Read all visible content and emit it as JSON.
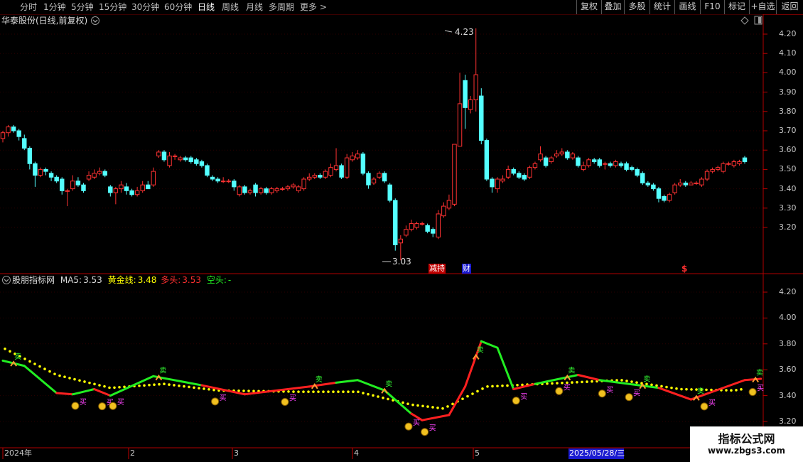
{
  "toolbar": {
    "periods": [
      "分时",
      "1分钟",
      "5分钟",
      "15分钟",
      "30分钟",
      "60分钟",
      "日线",
      "周线",
      "月线",
      "多周期",
      "更多 >"
    ],
    "active_period": "日线",
    "right_buttons": [
      "复权",
      "叠加",
      "多股",
      "统计",
      "画线",
      "F10",
      "标记",
      "+自选",
      "返回"
    ]
  },
  "main_panel": {
    "title": "华泰股份(日线,前复权)",
    "high_label": "4.23",
    "low_label": "3.03",
    "event_markers": [
      "减持",
      "财"
    ],
    "s_marker": "$",
    "y_ticks": [
      "4.20",
      "4.10",
      "4.00",
      "3.90",
      "3.80",
      "3.70",
      "3.60",
      "3.50",
      "3.40",
      "3.30",
      "3.20"
    ]
  },
  "indicator_panel": {
    "name": "股朋指标网",
    "ma5_label": "MA5:",
    "ma5_value": "3.53",
    "gold_label": "黄金线:",
    "gold_value": "3.48",
    "long_label": "多头:",
    "long_value": "3.53",
    "short_label": "空头:",
    "short_value": "-",
    "buy_text": "买",
    "sell_text": "卖",
    "y_ticks": [
      "4.20",
      "4.00",
      "3.80",
      "3.60",
      "3.40",
      "3.20"
    ]
  },
  "date_axis": {
    "labels": [
      "2024年",
      "2",
      "3",
      "4",
      "5"
    ],
    "cursor_date": "2025/05/28/三"
  },
  "watermark": {
    "line1": "指标公式网",
    "line2": "www.zbgs3.com"
  },
  "colors": {
    "up": "#ff3232",
    "down": "#54ffff",
    "gold_line": "#ffff00",
    "long_line": "#ff2020",
    "short_line": "#22ee22",
    "axis": "#c00000"
  },
  "chart_data": {
    "type": "candlestick",
    "ylim": [
      3.03,
      4.23
    ],
    "candles": [
      {
        "o": 3.66,
        "c": 3.69,
        "h": 3.7,
        "l": 3.64
      },
      {
        "o": 3.69,
        "c": 3.72,
        "h": 3.73,
        "l": 3.67
      },
      {
        "o": 3.72,
        "c": 3.7,
        "h": 3.73,
        "l": 3.69
      },
      {
        "o": 3.7,
        "c": 3.67,
        "h": 3.71,
        "l": 3.65
      },
      {
        "o": 3.66,
        "c": 3.61,
        "h": 3.68,
        "l": 3.6
      },
      {
        "o": 3.61,
        "c": 3.53,
        "h": 3.62,
        "l": 3.5
      },
      {
        "o": 3.53,
        "c": 3.47,
        "h": 3.54,
        "l": 3.41
      },
      {
        "o": 3.47,
        "c": 3.5,
        "h": 3.51,
        "l": 3.46
      },
      {
        "o": 3.5,
        "c": 3.49,
        "h": 3.51,
        "l": 3.47
      },
      {
        "o": 3.48,
        "c": 3.46,
        "h": 3.49,
        "l": 3.44
      },
      {
        "o": 3.46,
        "c": 3.44,
        "h": 3.47,
        "l": 3.43
      },
      {
        "o": 3.45,
        "c": 3.39,
        "h": 3.46,
        "l": 3.37
      },
      {
        "o": 3.39,
        "c": 3.39,
        "h": 3.4,
        "l": 3.31
      },
      {
        "o": 3.4,
        "c": 3.44,
        "h": 3.47,
        "l": 3.39
      },
      {
        "o": 3.44,
        "c": 3.42,
        "h": 3.46,
        "l": 3.41
      },
      {
        "o": 3.42,
        "c": 3.39,
        "h": 3.43,
        "l": 3.38
      },
      {
        "o": 3.45,
        "c": 3.47,
        "h": 3.49,
        "l": 3.44
      },
      {
        "o": 3.46,
        "c": 3.48,
        "h": 3.5,
        "l": 3.45
      },
      {
        "o": 3.48,
        "c": 3.49,
        "h": 3.51,
        "l": 3.47
      },
      {
        "o": 3.49,
        "c": 3.47,
        "h": 3.5,
        "l": 3.46
      },
      {
        "o": 3.41,
        "c": 3.38,
        "h": 3.42,
        "l": 3.36
      },
      {
        "o": 3.38,
        "c": 3.4,
        "h": 3.41,
        "l": 3.32
      },
      {
        "o": 3.4,
        "c": 3.42,
        "h": 3.44,
        "l": 3.38
      },
      {
        "o": 3.41,
        "c": 3.39,
        "h": 3.43,
        "l": 3.37
      },
      {
        "o": 3.39,
        "c": 3.37,
        "h": 3.4,
        "l": 3.36
      },
      {
        "o": 3.37,
        "c": 3.39,
        "h": 3.41,
        "l": 3.36
      },
      {
        "o": 3.39,
        "c": 3.42,
        "h": 3.44,
        "l": 3.38
      },
      {
        "o": 3.42,
        "c": 3.4,
        "h": 3.44,
        "l": 3.4
      },
      {
        "o": 3.42,
        "c": 3.49,
        "h": 3.51,
        "l": 3.41
      },
      {
        "o": 3.57,
        "c": 3.59,
        "h": 3.6,
        "l": 3.56
      },
      {
        "o": 3.59,
        "c": 3.55,
        "h": 3.6,
        "l": 3.54
      },
      {
        "o": 3.52,
        "c": 3.57,
        "h": 3.59,
        "l": 3.51
      },
      {
        "o": 3.57,
        "c": 3.57,
        "h": 3.58,
        "l": 3.55
      },
      {
        "o": 3.55,
        "c": 3.56,
        "h": 3.57,
        "l": 3.54
      },
      {
        "o": 3.56,
        "c": 3.55,
        "h": 3.57,
        "l": 3.54
      },
      {
        "o": 3.56,
        "c": 3.54,
        "h": 3.57,
        "l": 3.53
      },
      {
        "o": 3.55,
        "c": 3.53,
        "h": 3.56,
        "l": 3.52
      },
      {
        "o": 3.54,
        "c": 3.52,
        "h": 3.55,
        "l": 3.51
      },
      {
        "o": 3.52,
        "c": 3.47,
        "h": 3.53,
        "l": 3.46
      },
      {
        "o": 3.46,
        "c": 3.45,
        "h": 3.47,
        "l": 3.44
      },
      {
        "o": 3.45,
        "c": 3.44,
        "h": 3.46,
        "l": 3.43
      },
      {
        "o": 3.44,
        "c": 3.44,
        "h": 3.46,
        "l": 3.43
      },
      {
        "o": 3.44,
        "c": 3.44,
        "h": 3.45,
        "l": 3.43
      },
      {
        "o": 3.44,
        "c": 3.41,
        "h": 3.45,
        "l": 3.39
      },
      {
        "o": 3.37,
        "c": 3.41,
        "h": 3.42,
        "l": 3.36
      },
      {
        "o": 3.41,
        "c": 3.38,
        "h": 3.42,
        "l": 3.37
      },
      {
        "o": 3.38,
        "c": 3.39,
        "h": 3.4,
        "l": 3.37
      },
      {
        "o": 3.42,
        "c": 3.38,
        "h": 3.43,
        "l": 3.36
      },
      {
        "o": 3.38,
        "c": 3.4,
        "h": 3.41,
        "l": 3.37
      },
      {
        "o": 3.4,
        "c": 3.38,
        "h": 3.41,
        "l": 3.37
      },
      {
        "o": 3.38,
        "c": 3.4,
        "h": 3.41,
        "l": 3.37
      },
      {
        "o": 3.39,
        "c": 3.4,
        "h": 3.41,
        "l": 3.38
      },
      {
        "o": 3.4,
        "c": 3.4,
        "h": 3.41,
        "l": 3.39
      },
      {
        "o": 3.4,
        "c": 3.41,
        "h": 3.42,
        "l": 3.39
      },
      {
        "o": 3.41,
        "c": 3.42,
        "h": 3.43,
        "l": 3.4
      },
      {
        "o": 3.39,
        "c": 3.41,
        "h": 3.42,
        "l": 3.38
      },
      {
        "o": 3.4,
        "c": 3.45,
        "h": 3.46,
        "l": 3.39
      },
      {
        "o": 3.45,
        "c": 3.46,
        "h": 3.48,
        "l": 3.44
      },
      {
        "o": 3.46,
        "c": 3.47,
        "h": 3.48,
        "l": 3.45
      },
      {
        "o": 3.47,
        "c": 3.46,
        "h": 3.48,
        "l": 3.45
      },
      {
        "o": 3.46,
        "c": 3.49,
        "h": 3.5,
        "l": 3.45
      },
      {
        "o": 3.47,
        "c": 3.51,
        "h": 3.53,
        "l": 3.46
      },
      {
        "o": 3.5,
        "c": 3.52,
        "h": 3.61,
        "l": 3.49
      },
      {
        "o": 3.52,
        "c": 3.46,
        "h": 3.53,
        "l": 3.45
      },
      {
        "o": 3.46,
        "c": 3.56,
        "h": 3.58,
        "l": 3.45
      },
      {
        "o": 3.55,
        "c": 3.57,
        "h": 3.59,
        "l": 3.54
      },
      {
        "o": 3.56,
        "c": 3.58,
        "h": 3.6,
        "l": 3.55
      },
      {
        "o": 3.58,
        "c": 3.48,
        "h": 3.59,
        "l": 3.47
      },
      {
        "o": 3.48,
        "c": 3.42,
        "h": 3.49,
        "l": 3.4
      },
      {
        "o": 3.43,
        "c": 3.45,
        "h": 3.46,
        "l": 3.42
      },
      {
        "o": 3.46,
        "c": 3.48,
        "h": 3.49,
        "l": 3.45
      },
      {
        "o": 3.48,
        "c": 3.44,
        "h": 3.49,
        "l": 3.43
      },
      {
        "o": 3.42,
        "c": 3.34,
        "h": 3.43,
        "l": 3.33
      },
      {
        "o": 3.34,
        "c": 3.11,
        "h": 3.35,
        "l": 3.08
      },
      {
        "o": 3.12,
        "c": 3.14,
        "h": 3.16,
        "l": 3.03
      },
      {
        "o": 3.16,
        "c": 3.19,
        "h": 3.21,
        "l": 3.15
      },
      {
        "o": 3.19,
        "c": 3.22,
        "h": 3.24,
        "l": 3.18
      },
      {
        "o": 3.2,
        "c": 3.22,
        "h": 3.23,
        "l": 3.19
      },
      {
        "o": 3.22,
        "c": 3.22,
        "h": 3.23,
        "l": 3.21
      },
      {
        "o": 3.21,
        "c": 3.18,
        "h": 3.22,
        "l": 3.17
      },
      {
        "o": 3.19,
        "c": 3.17,
        "h": 3.2,
        "l": 3.15
      },
      {
        "o": 3.15,
        "c": 3.27,
        "h": 3.29,
        "l": 3.14
      },
      {
        "o": 3.26,
        "c": 3.31,
        "h": 3.33,
        "l": 3.25
      },
      {
        "o": 3.3,
        "c": 3.34,
        "h": 3.37,
        "l": 3.29
      },
      {
        "o": 3.32,
        "c": 3.63,
        "h": 3.63,
        "l": 3.31
      },
      {
        "o": 3.62,
        "c": 3.84,
        "h": 4.0,
        "l": 3.62
      },
      {
        "o": 3.96,
        "c": 3.82,
        "h": 3.99,
        "l": 3.71
      },
      {
        "o": 3.81,
        "c": 3.86,
        "h": 3.88,
        "l": 3.79
      },
      {
        "o": 3.86,
        "c": 3.99,
        "h": 4.23,
        "l": 3.8
      },
      {
        "o": 3.88,
        "c": 3.65,
        "h": 3.92,
        "l": 3.63
      },
      {
        "o": 3.65,
        "c": 3.45,
        "h": 3.66,
        "l": 3.44
      },
      {
        "o": 3.45,
        "c": 3.41,
        "h": 3.46,
        "l": 3.38
      },
      {
        "o": 3.4,
        "c": 3.45,
        "h": 3.46,
        "l": 3.38
      },
      {
        "o": 3.44,
        "c": 3.45,
        "h": 3.47,
        "l": 3.43
      },
      {
        "o": 3.46,
        "c": 3.5,
        "h": 3.52,
        "l": 3.45
      },
      {
        "o": 3.5,
        "c": 3.48,
        "h": 3.51,
        "l": 3.47
      },
      {
        "o": 3.48,
        "c": 3.46,
        "h": 3.49,
        "l": 3.45
      },
      {
        "o": 3.47,
        "c": 3.45,
        "h": 3.48,
        "l": 3.44
      },
      {
        "o": 3.46,
        "c": 3.51,
        "h": 3.52,
        "l": 3.45
      },
      {
        "o": 3.51,
        "c": 3.53,
        "h": 3.54,
        "l": 3.5
      },
      {
        "o": 3.55,
        "c": 3.58,
        "h": 3.62,
        "l": 3.54
      },
      {
        "o": 3.56,
        "c": 3.52,
        "h": 3.57,
        "l": 3.51
      },
      {
        "o": 3.54,
        "c": 3.56,
        "h": 3.57,
        "l": 3.53
      },
      {
        "o": 3.57,
        "c": 3.58,
        "h": 3.6,
        "l": 3.56
      },
      {
        "o": 3.58,
        "c": 3.59,
        "h": 3.61,
        "l": 3.57
      },
      {
        "o": 3.59,
        "c": 3.56,
        "h": 3.6,
        "l": 3.55
      },
      {
        "o": 3.56,
        "c": 3.58,
        "h": 3.59,
        "l": 3.55
      },
      {
        "o": 3.56,
        "c": 3.52,
        "h": 3.57,
        "l": 3.51
      },
      {
        "o": 3.5,
        "c": 3.52,
        "h": 3.54,
        "l": 3.49
      },
      {
        "o": 3.52,
        "c": 3.55,
        "h": 3.56,
        "l": 3.51
      },
      {
        "o": 3.55,
        "c": 3.54,
        "h": 3.56,
        "l": 3.53
      },
      {
        "o": 3.55,
        "c": 3.52,
        "h": 3.56,
        "l": 3.51
      },
      {
        "o": 3.53,
        "c": 3.53,
        "h": 3.54,
        "l": 3.5
      },
      {
        "o": 3.53,
        "c": 3.52,
        "h": 3.54,
        "l": 3.51
      },
      {
        "o": 3.52,
        "c": 3.54,
        "h": 3.55,
        "l": 3.51
      },
      {
        "o": 3.53,
        "c": 3.52,
        "h": 3.54,
        "l": 3.51
      },
      {
        "o": 3.53,
        "c": 3.5,
        "h": 3.54,
        "l": 3.49
      },
      {
        "o": 3.51,
        "c": 3.5,
        "h": 3.52,
        "l": 3.49
      },
      {
        "o": 3.5,
        "c": 3.47,
        "h": 3.51,
        "l": 3.46
      },
      {
        "o": 3.48,
        "c": 3.43,
        "h": 3.49,
        "l": 3.42
      },
      {
        "o": 3.43,
        "c": 3.42,
        "h": 3.44,
        "l": 3.41
      },
      {
        "o": 3.42,
        "c": 3.4,
        "h": 3.43,
        "l": 3.39
      },
      {
        "o": 3.4,
        "c": 3.35,
        "h": 3.41,
        "l": 3.33
      },
      {
        "o": 3.36,
        "c": 3.34,
        "h": 3.37,
        "l": 3.33
      },
      {
        "o": 3.34,
        "c": 3.37,
        "h": 3.38,
        "l": 3.33
      },
      {
        "o": 3.38,
        "c": 3.42,
        "h": 3.43,
        "l": 3.37
      },
      {
        "o": 3.42,
        "c": 3.43,
        "h": 3.45,
        "l": 3.41
      },
      {
        "o": 3.43,
        "c": 3.42,
        "h": 3.44,
        "l": 3.41
      },
      {
        "o": 3.42,
        "c": 3.43,
        "h": 3.44,
        "l": 3.42
      },
      {
        "o": 3.43,
        "c": 3.43,
        "h": 3.44,
        "l": 3.42
      },
      {
        "o": 3.42,
        "c": 3.45,
        "h": 3.46,
        "l": 3.41
      },
      {
        "o": 3.45,
        "c": 3.49,
        "h": 3.5,
        "l": 3.44
      },
      {
        "o": 3.49,
        "c": 3.5,
        "h": 3.51,
        "l": 3.48
      },
      {
        "o": 3.5,
        "c": 3.51,
        "h": 3.52,
        "l": 3.49
      },
      {
        "o": 3.49,
        "c": 3.53,
        "h": 3.54,
        "l": 3.48
      },
      {
        "o": 3.53,
        "c": 3.53,
        "h": 3.54,
        "l": 3.52
      },
      {
        "o": 3.52,
        "c": 3.54,
        "h": 3.55,
        "l": 3.51
      },
      {
        "o": 3.53,
        "c": 3.54,
        "h": 3.55,
        "l": 3.52
      },
      {
        "o": 3.56,
        "c": 3.54,
        "h": 3.57,
        "l": 3.53
      }
    ],
    "indicator": {
      "ylim": [
        3.2,
        4.2
      ],
      "ma_line": [
        {
          "i": 0,
          "v": 3.67,
          "t": "short"
        },
        {
          "i": 4,
          "v": 3.63,
          "t": "short"
        },
        {
          "i": 10,
          "v": 3.42,
          "t": "short"
        },
        {
          "i": 13,
          "v": 3.41,
          "t": "long"
        },
        {
          "i": 17,
          "v": 3.45,
          "t": "short"
        },
        {
          "i": 20,
          "v": 3.4,
          "t": "long"
        },
        {
          "i": 28,
          "v": 3.55,
          "t": "short"
        },
        {
          "i": 37,
          "v": 3.48,
          "t": "short"
        },
        {
          "i": 45,
          "v": 3.41,
          "t": "long"
        },
        {
          "i": 57,
          "v": 3.47,
          "t": "long"
        },
        {
          "i": 62,
          "v": 3.5,
          "t": "long"
        },
        {
          "i": 66,
          "v": 3.52,
          "t": "short"
        },
        {
          "i": 71,
          "v": 3.44,
          "t": "short"
        },
        {
          "i": 76,
          "v": 3.26,
          "t": "short"
        },
        {
          "i": 78,
          "v": 3.21,
          "t": "long"
        },
        {
          "i": 83,
          "v": 3.25,
          "t": "long"
        },
        {
          "i": 86,
          "v": 3.47,
          "t": "long"
        },
        {
          "i": 89,
          "v": 3.82,
          "t": "long"
        },
        {
          "i": 92,
          "v": 3.77,
          "t": "short"
        },
        {
          "i": 95,
          "v": 3.45,
          "t": "short"
        },
        {
          "i": 99,
          "v": 3.49,
          "t": "long"
        },
        {
          "i": 107,
          "v": 3.56,
          "t": "short"
        },
        {
          "i": 111,
          "v": 3.52,
          "t": "long"
        },
        {
          "i": 122,
          "v": 3.46,
          "t": "short"
        },
        {
          "i": 128,
          "v": 3.37,
          "t": "long"
        },
        {
          "i": 138,
          "v": 3.52,
          "t": "long"
        },
        {
          "i": 141,
          "v": 3.53,
          "t": "long"
        }
      ],
      "gold_line": [
        {
          "i": 0,
          "v": 3.77
        },
        {
          "i": 10,
          "v": 3.56
        },
        {
          "i": 20,
          "v": 3.46
        },
        {
          "i": 30,
          "v": 3.49
        },
        {
          "i": 40,
          "v": 3.44
        },
        {
          "i": 55,
          "v": 3.43
        },
        {
          "i": 66,
          "v": 3.43
        },
        {
          "i": 76,
          "v": 3.33
        },
        {
          "i": 82,
          "v": 3.3
        },
        {
          "i": 90,
          "v": 3.47
        },
        {
          "i": 100,
          "v": 3.49
        },
        {
          "i": 115,
          "v": 3.52
        },
        {
          "i": 126,
          "v": 3.45
        },
        {
          "i": 136,
          "v": 3.44
        },
        {
          "i": 141,
          "v": 3.47
        }
      ],
      "buy_points": [
        14,
        19,
        21,
        40,
        53,
        76,
        79,
        96,
        104,
        112,
        117,
        131,
        140
      ],
      "sell_points": [
        2,
        29,
        58,
        71,
        88,
        105,
        119,
        129,
        140
      ]
    }
  }
}
